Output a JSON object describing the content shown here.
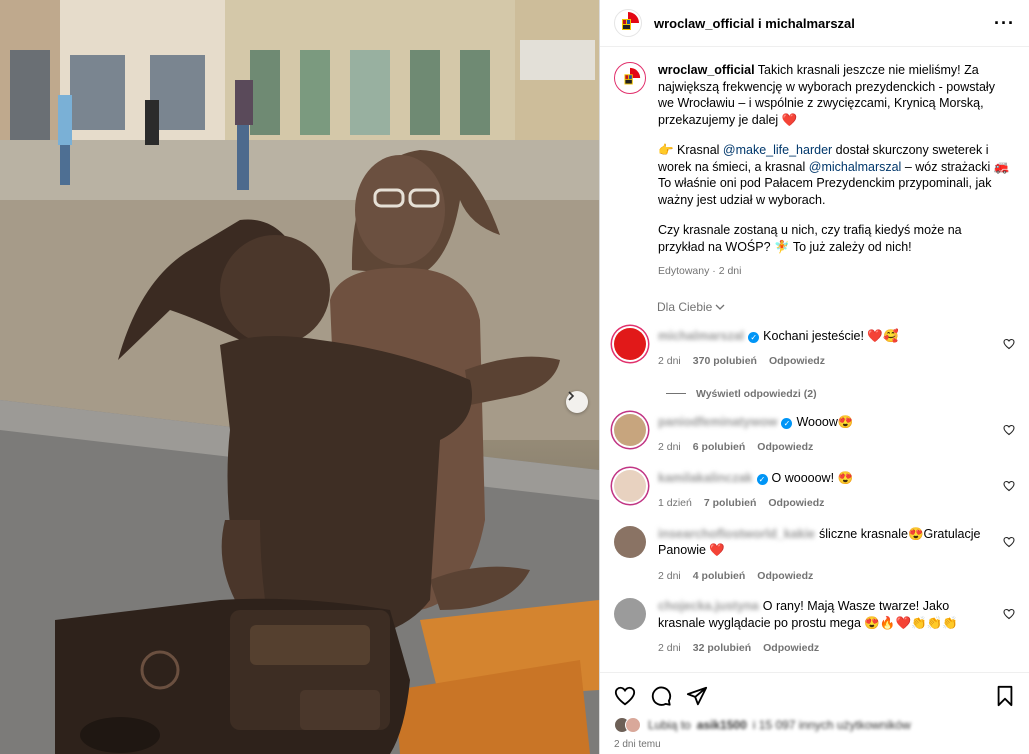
{
  "header": {
    "account": "wroclaw_official",
    "connector": "i",
    "collaborator": "michalmarszal",
    "more": "···"
  },
  "caption": {
    "author": "wroclaw_official",
    "p1": " Takich krasnali jeszcze nie mieliśmy! Za największą frekwencję w wyborach prezydenckich - powstały we Wrocławiu – i wspólnie z zwycięzcami, Krynicą Morską, przekazujemy je dalej ❤️",
    "p2_a": "👉 Krasnal ",
    "p2_m1": "@make_life_harder",
    "p2_b": " dostał skurczony sweterek i worek na śmieci, a krasnal ",
    "p2_m2": "@michalmarszal",
    "p2_c": " – wóz strażacki 🚒 To właśnie oni pod Pałacem Prezydenckim przypominali, jak ważny jest udział w wyborach.",
    "p3": "Czy krasnale zostaną u nich, czy trafią kiedyś może na przykład na WOŚP? 🧚 To już zależy od nich!",
    "edited": "Edytowany · 2 dni"
  },
  "filter": {
    "label": "Dla Ciebie"
  },
  "comments": [
    {
      "user": "michalmarszal",
      "verified": true,
      "text": "Kochani jesteście! ❤️🥰",
      "age": "2 dni",
      "likes": "370 polubień",
      "reply": "Odpowiedz",
      "avatar_color": "#e11919",
      "ring": "#e1306c"
    },
    {
      "user": "paniodfeminatywow",
      "verified": true,
      "text": "Wooow😍",
      "age": "2 dni",
      "likes": "6 polubień",
      "reply": "Odpowiedz",
      "avatar_color": "#c7a57e",
      "ring": "#c13584"
    },
    {
      "user": "kamilakalinczak",
      "verified": true,
      "text": "O woooow! 😍",
      "age": "1 dzień",
      "likes": "7 polubień",
      "reply": "Odpowiedz",
      "avatar_color": "#e8d2c0",
      "ring": "#c13584"
    },
    {
      "user": "insearchoflostworld_kakie",
      "verified": false,
      "text": "śliczne krasnale😍Gratulacje Panowie ❤️",
      "age": "2 dni",
      "likes": "4 polubień",
      "reply": "Odpowiedz",
      "avatar_color": "#8a7364",
      "ring": ""
    },
    {
      "user": "chojecka.justyna",
      "verified": false,
      "text": "O rany! Mają Wasze twarze! Jako krasnale wyglądacie po prostu mega 😍🔥❤️👏👏👏",
      "age": "2 dni",
      "likes": "32 polubień",
      "reply": "Odpowiedz",
      "avatar_color": "#9b9b9b",
      "ring": ""
    }
  ],
  "replies_link": "Wyświetl odpowiedzi (2)",
  "footer": {
    "likes_prefix": "Lubią to",
    "likes_user": "asik1500",
    "likes_rest": "i 15 097 innych użytkowników",
    "posted": "2 dni temu"
  },
  "colors": {
    "link": "#00376b",
    "muted": "#737373",
    "verified": "#0095f6"
  },
  "icons": [
    "more-icon",
    "heart-icon",
    "comment-icon",
    "share-icon",
    "bookmark-icon",
    "chevron-down-icon",
    "chevron-right-icon",
    "verified-icon"
  ]
}
